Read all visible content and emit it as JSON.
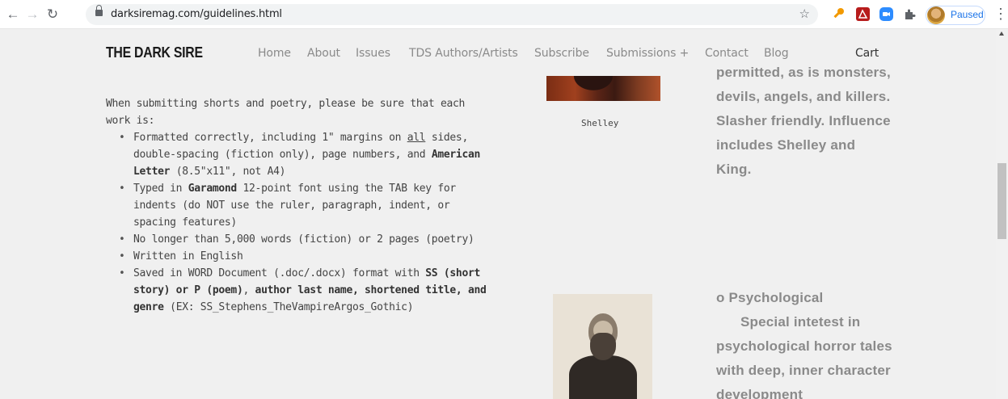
{
  "browser": {
    "url": "darksiremag.com/guidelines.html",
    "profile_status": "Paused",
    "icons": [
      "back-arrow-icon",
      "forward-arrow-icon",
      "reload-icon",
      "lock-icon",
      "star-icon",
      "key-extension-icon",
      "pdf-extension-icon",
      "zoom-extension-icon",
      "puzzle-extensions-icon",
      "profile-avatar-icon",
      "menu-dots-icon"
    ],
    "colors": {
      "accent": "#1a73e8"
    }
  },
  "site": {
    "logo": "THE DARK SIRE",
    "nav": [
      "Home",
      "About",
      "Issues",
      "TDS Authors/Artists",
      "Subscribe",
      "Submissions +",
      "Contact",
      "Blog"
    ],
    "cart": "Cart"
  },
  "guidelines": {
    "intro": "When submitting shorts and poetry, please be sure that each work is:",
    "items": [
      {
        "parts": [
          "Formatted correctly, including 1\" margins on ",
          "all",
          " sides, double-spacing (fiction only), page numbers, and ",
          "American Letter",
          " (8.5\"x11\", not A4)"
        ]
      },
      {
        "parts": [
          "Typed in ",
          "Garamond",
          " 12-point font using the TAB key for indents (do NOT use the ruler, paragraph, indent, or spacing features)"
        ]
      },
      {
        "parts": [
          "No longer than 5,000 words (fiction) or 2 pages (poetry)"
        ]
      },
      {
        "parts": [
          "Written in English"
        ]
      },
      {
        "parts": [
          "Saved in WORD Document (.doc/.docx) format with ",
          "SS (short story) or P (poem)",
          ", ",
          "author last name, shortened title, and genre",
          " (EX: SS_Stephens_TheVampireArgos_Gothic)"
        ]
      }
    ]
  },
  "figures": {
    "shelley_caption": "Shelley"
  },
  "sidebar": {
    "block1": "permitted, as is monsters, devils, angels, and killers. Slasher friendly. Influence includes Shelley and King.",
    "block2_heading": "o Psychological",
    "block2_text": "Special intetest in psychological horror tales with deep, inner character development"
  }
}
